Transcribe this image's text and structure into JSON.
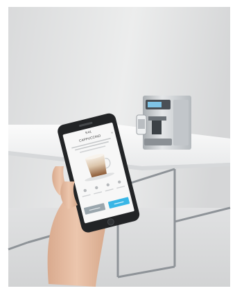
{
  "scene": {
    "app_screen": {
      "status_time": "9:41",
      "title": "CAPPUCCINO",
      "primary_button": "",
      "secondary_button": ""
    }
  },
  "colors": {
    "wall": "#e6e7e8",
    "table_top": "#f2f2f2",
    "phone_body": "#222426",
    "screen_bg": "#f7f7f7",
    "accent": "#38b6e6",
    "secondary_btn": "#9aa6ad",
    "skin": "#e8c1a8",
    "machine_silver": "#c9cdd1"
  }
}
